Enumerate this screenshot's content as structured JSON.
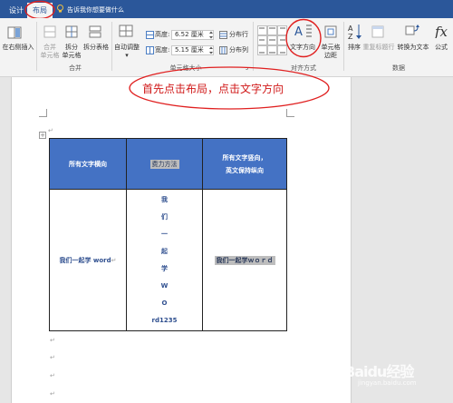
{
  "tabs": {
    "design": "设计",
    "layout": "布局",
    "tell_me": "告诉我你想要做什么"
  },
  "ribbon": {
    "insert_right": "在右侧插入",
    "merge_cells": "合并\n单元格",
    "split_cells": "拆分\n单元格",
    "split_table": "拆分表格",
    "merge_group": "合并",
    "autofit": "自动调整",
    "height_label": "高度:",
    "height_value": "6.52 厘米",
    "width_label": "宽度:",
    "width_value": "5.15 厘米",
    "distribute_rows": "分布行",
    "distribute_cols": "分布列",
    "cell_size_group": "单元格大小",
    "text_direction": "文字方向",
    "cell_margins": "单元格\n边距",
    "alignment_group": "对齐方式",
    "sort": "排序",
    "repeat_header": "重复标题行",
    "convert_to_text": "转换为文本",
    "formula": "公式",
    "data_group": "数据"
  },
  "annotation": "首先点击布局，点击文字方向",
  "table": {
    "headers": [
      "所有文字横向",
      "费力方法",
      "所有文字竖向，\n英文保持纵向"
    ],
    "cell1": "我们一起学 word",
    "cell2_lines": [
      "我",
      "们",
      "一",
      "起",
      "学",
      "W",
      "O",
      "rd1235"
    ],
    "cell3": "我们一起学ｗｏｒｄ"
  },
  "watermark": "Baidu经验",
  "watermark_url": "jingyan.baidu.com",
  "colors": {
    "tab_bar": "#2b579a",
    "header_fill": "#4472c4",
    "annotation": "#d01818"
  }
}
